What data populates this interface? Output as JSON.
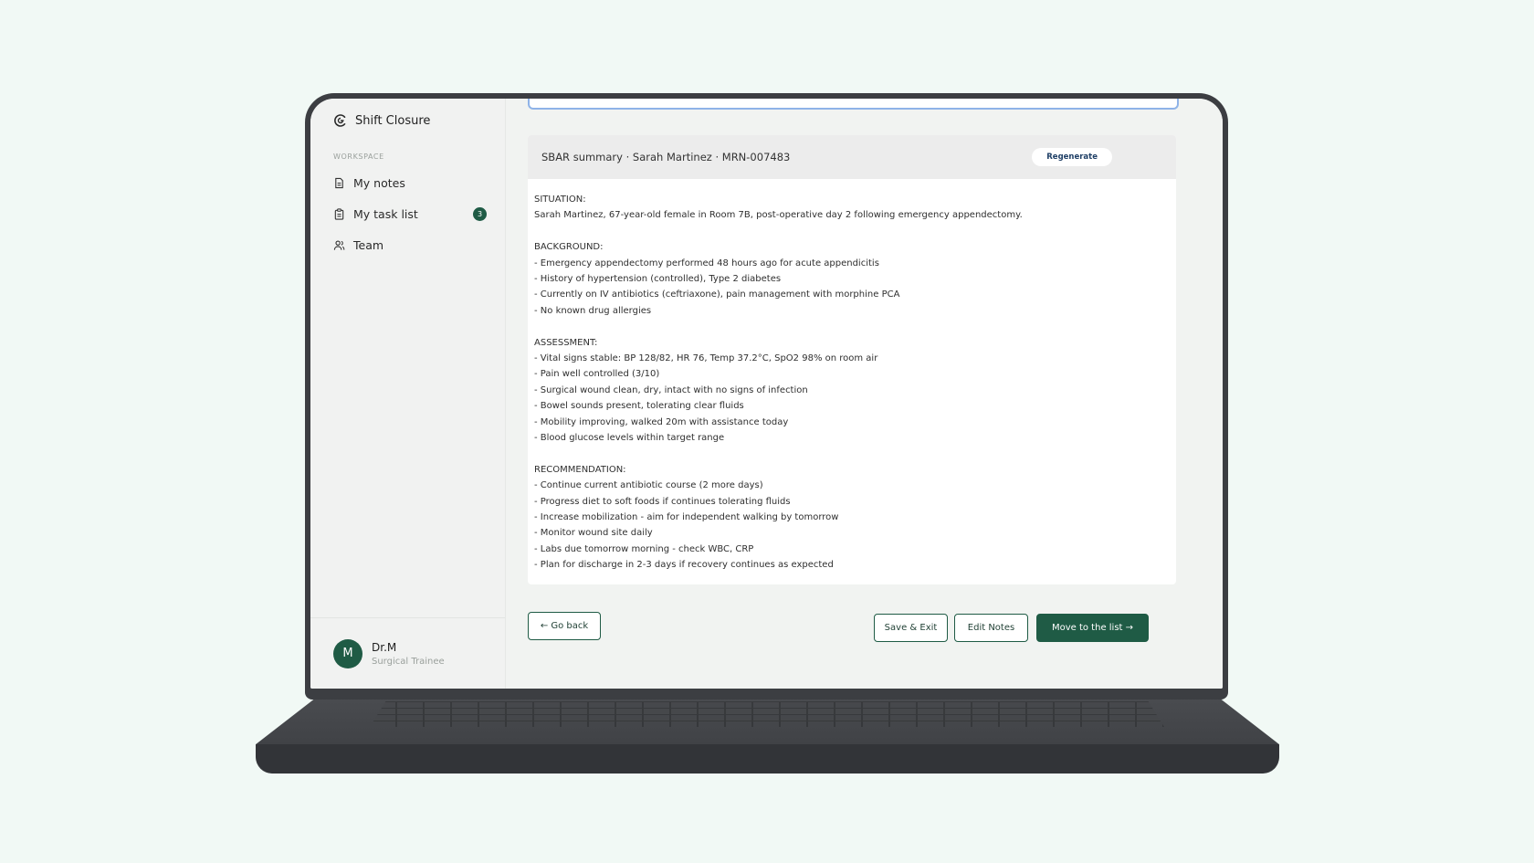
{
  "app": {
    "title": "Shift Closure"
  },
  "sidebar": {
    "section_label": "WORKSPACE",
    "items": [
      {
        "label": "My notes",
        "icon": "document-icon"
      },
      {
        "label": "My task list",
        "icon": "clipboard-icon",
        "badge": "3"
      },
      {
        "label": "Team",
        "icon": "users-icon"
      }
    ],
    "user": {
      "initial": "M",
      "name": "Dr.M",
      "role": "Surgical Trainee"
    }
  },
  "summary": {
    "title": "SBAR summary · Sarah Martinez · MRN-007483",
    "regenerate_label": "Regenerate",
    "sections": [
      {
        "heading": "SITUATION:",
        "lines": [
          "Sarah Martinez, 67-year-old female in Room 7B, post-operative day 2 following emergency appendectomy."
        ]
      },
      {
        "heading": "BACKGROUND:",
        "lines": [
          "- Emergency appendectomy performed 48 hours ago for acute appendicitis",
          "- History of hypertension (controlled), Type 2 diabetes",
          "- Currently on IV antibiotics (ceftriaxone), pain management with morphine PCA",
          "- No known drug allergies"
        ]
      },
      {
        "heading": "ASSESSMENT:",
        "lines": [
          "- Vital signs stable: BP 128/82, HR 76, Temp 37.2°C, SpO2 98% on room air",
          "- Pain well controlled (3/10)",
          "- Surgical wound clean, dry, intact with no signs of infection",
          "- Bowel sounds present, tolerating clear fluids",
          "- Mobility improving, walked 20m with assistance today",
          "- Blood glucose levels within target range"
        ]
      },
      {
        "heading": "RECOMMENDATION:",
        "lines": [
          "- Continue current antibiotic course (2 more days)",
          "- Progress diet to soft foods if continues tolerating fluids",
          "- Increase mobilization - aim for independent walking by tomorrow",
          "- Monitor wound site daily",
          "- Labs due tomorrow morning - check WBC, CRP",
          "- Plan for discharge in 2-3 days if recovery continues as expected"
        ]
      }
    ]
  },
  "actions": {
    "go_back": "← Go back",
    "save_exit": "Save & Exit",
    "edit_notes": "Edit Notes",
    "move_to_list": "Move to the list →"
  },
  "colors": {
    "brand": "#1f5b45",
    "accent_outline": "#8fb3e8"
  }
}
